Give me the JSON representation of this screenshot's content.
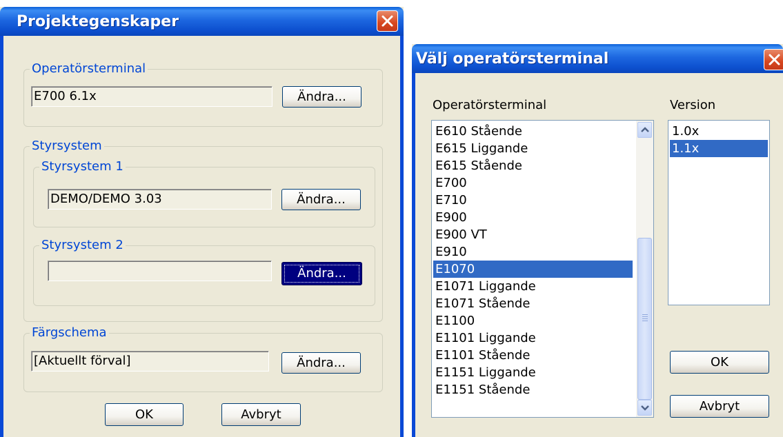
{
  "dialog1": {
    "title": "Projektegenskaper",
    "operator_group": {
      "legend": "Operatörsterminal",
      "value": "E700 6.1x",
      "change_label": "Ändra..."
    },
    "control_group": {
      "legend": "Styrsystem",
      "system1": {
        "legend": "Styrsystem 1",
        "value": "DEMO/DEMO 3.03",
        "change_label": "Ändra..."
      },
      "system2": {
        "legend": "Styrsystem 2",
        "value": "",
        "change_label": "Ändra..."
      }
    },
    "color_group": {
      "legend": "Färgschema",
      "value": "[Aktuellt förval]",
      "change_label": "Ändra..."
    },
    "ok_label": "OK",
    "cancel_label": "Avbryt"
  },
  "dialog2": {
    "title": "Välj operatörsterminal",
    "terminal_header": "Operatörsterminal",
    "version_header": "Version",
    "terminals": [
      "E610 Stående",
      "E615 Liggande",
      "E615 Stående",
      "E700",
      "E710",
      "E900",
      "E900 VT",
      "E910",
      "E1070",
      "E1071 Liggande",
      "E1071 Stående",
      "E1100",
      "E1101 Liggande",
      "E1101 Stående",
      "E1151 Liggande",
      "E1151 Stående"
    ],
    "selected_terminal": "E1070",
    "versions": [
      "1.0x",
      "1.1x"
    ],
    "selected_version": "1.1x",
    "ok_label": "OK",
    "cancel_label": "Avbryt"
  },
  "icons": [
    "close-icon",
    "scroll-up-icon",
    "scroll-down-icon",
    "scroll-grip-icon"
  ],
  "colors": {
    "titlebar": "#0a5fd8",
    "dialog_bg": "#ece9d8",
    "group_label": "#0046d5",
    "selection": "#316ac5",
    "focused_button": "#000080"
  }
}
